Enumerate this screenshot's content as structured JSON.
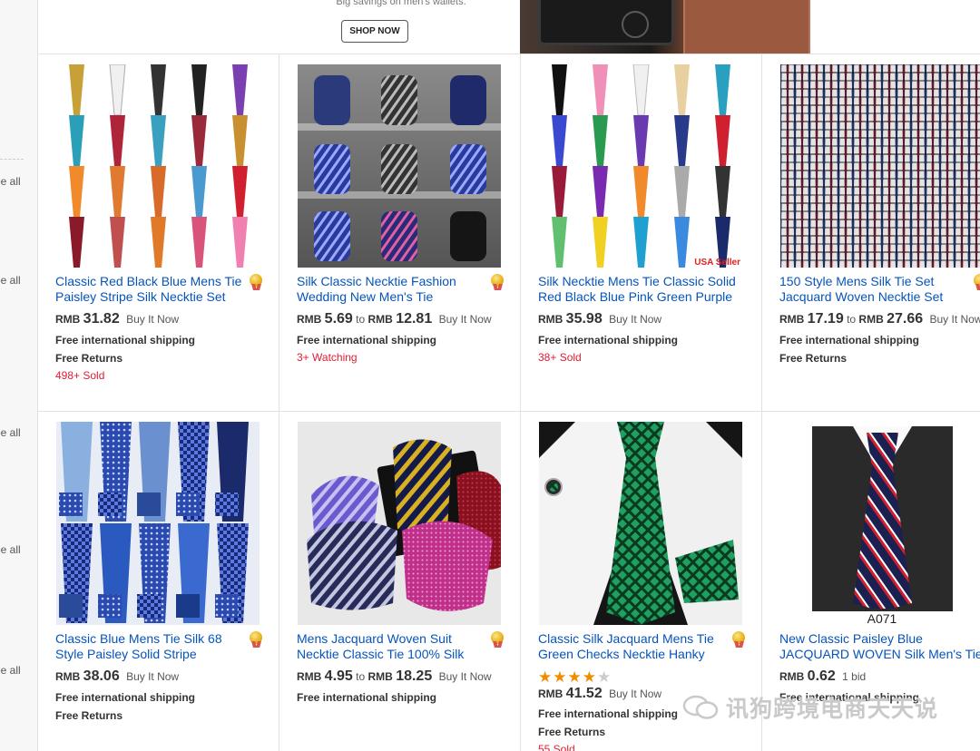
{
  "banner": {
    "text": "Big savings on men's wallets.",
    "button_label": "SHOP NOW"
  },
  "sidebar": {
    "see_all": [
      "ee all",
      "ee all",
      "ee all",
      "ee all",
      "ee all"
    ]
  },
  "listings": [
    {
      "title_line1": "Classic Red Black Blue Mens Tie",
      "title_line2": "Paisley Stripe Silk Necktie Set",
      "top_rated": true,
      "currency": "RMB",
      "price": "31.82",
      "format": "Buy It Now",
      "shipping": "Free international shipping",
      "returns": "Free Returns",
      "sold": "498+ Sold"
    },
    {
      "title_line1": "Silk Classic Necktie Fashion",
      "title_line2": "Wedding New Men's Tie",
      "top_rated": true,
      "currency": "RMB",
      "price": "5.69",
      "to": "to",
      "currency2": "RMB",
      "price2": "12.81",
      "format": "Buy It Now",
      "shipping": "Free international shipping",
      "watching": "3+ Watching"
    },
    {
      "title_line1": "Silk Necktie Mens Tie Classic Solid",
      "title_line2": "Red Black Blue Pink Green Purple",
      "currency": "RMB",
      "price": "35.98",
      "format": "Buy It Now",
      "shipping": "Free international shipping",
      "sold": "38+ Sold",
      "image_caption": "USA Seller"
    },
    {
      "title_line1": "150 Style Mens Silk Tie Set",
      "title_line2": "Jacquard Woven Necktie Set",
      "top_rated": true,
      "currency": "RMB",
      "price": "17.19",
      "to": "to",
      "currency2": "RMB",
      "price2": "27.66",
      "format": "Buy It Now",
      "shipping": "Free international shipping",
      "returns": "Free Returns"
    },
    {
      "title_line1": "Classic Blue Mens Tie Silk 68",
      "title_line2": "Style Paisley Solid Stripe",
      "top_rated": true,
      "currency": "RMB",
      "price": "38.06",
      "format": "Buy It Now",
      "shipping": "Free international shipping",
      "returns": "Free Returns"
    },
    {
      "title_line1": "Mens Jacquard Woven Suit",
      "title_line2": "Necktie Classic Tie 100% Silk",
      "top_rated": true,
      "currency": "RMB",
      "price": "4.95",
      "to": "to",
      "currency2": "RMB",
      "price2": "18.25",
      "format": "Buy It Now",
      "shipping": "Free international shipping"
    },
    {
      "title_line1": "Classic Silk Jacquard Mens Tie",
      "title_line2": "Green Checks Necktie Hanky",
      "top_rated": true,
      "rating": 4,
      "rating_max": 5,
      "currency": "RMB",
      "price": "41.52",
      "format": "Buy It Now",
      "shipping": "Free international shipping",
      "returns": "Free Returns",
      "sold": "55 Sold"
    },
    {
      "title_line1": "New Classic Paisley Blue",
      "title_line2": "JACQUARD WOVEN Silk Men's Tie",
      "currency": "RMB",
      "price": "0.62",
      "format": "1 bid",
      "shipping": "Free international shipping",
      "image_caption": "A071"
    }
  ],
  "watermark": "讯狗跨境电商天天说",
  "colors": {
    "link": "#0654ba",
    "sold_red": "#dd1e31",
    "star": "#f18c00"
  }
}
